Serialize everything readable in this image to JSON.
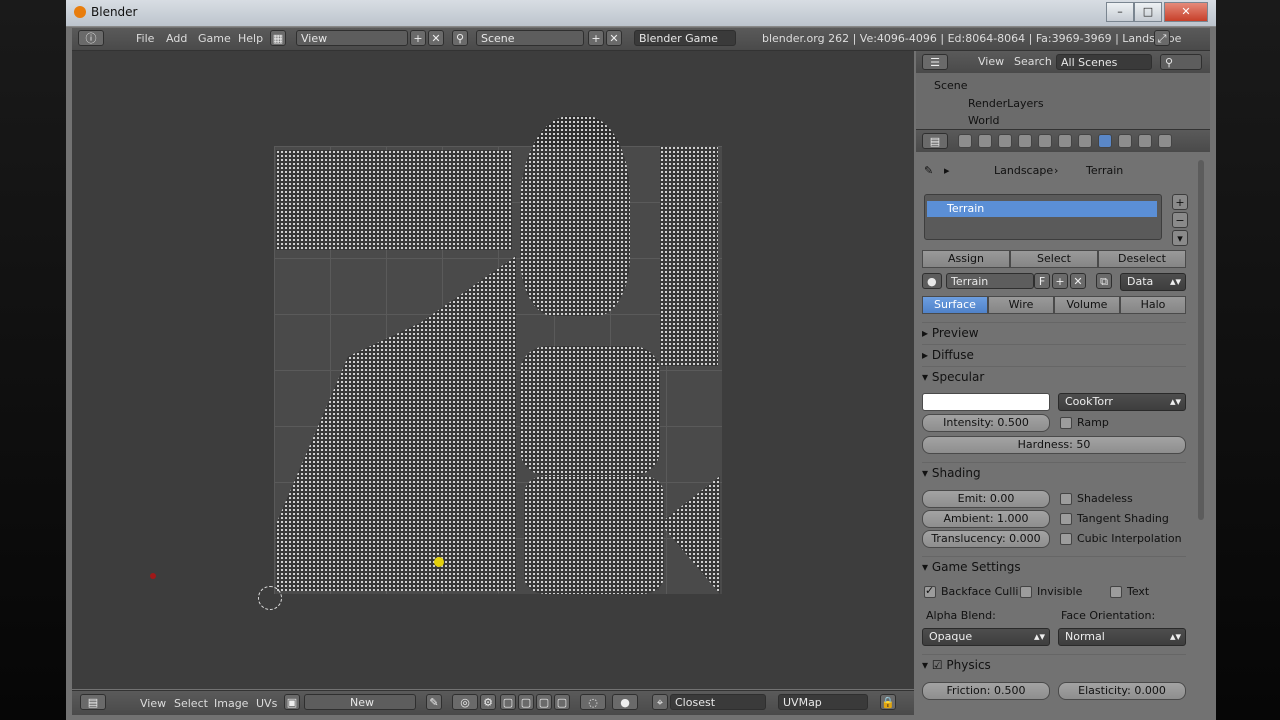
{
  "window": {
    "title": "Blender",
    "min": "–",
    "max": "□",
    "close": "✕"
  },
  "menu": {
    "file": "File",
    "add": "Add",
    "game": "Game",
    "help": "Help",
    "screen": "View",
    "scene": "Scene",
    "engine": "Blender Game",
    "info": "blender.org 262 | Ve:4096-4096 | Ed:8064-8064 | Fa:3969-3969 | Landscape"
  },
  "uv_editor": {
    "view": "View",
    "select": "Select",
    "image": "Image",
    "uvs": "UVs",
    "new_button": "New",
    "sticky_mode": "Closest",
    "uvmap": "UVMap"
  },
  "outliner": {
    "view": "View",
    "search": "Search",
    "filter": "All Scenes",
    "items": [
      "Scene",
      "RenderLayers",
      "World"
    ]
  },
  "properties": {
    "breadcrumb": [
      "Landscape",
      "Terrain"
    ],
    "slot_name": "Terrain",
    "assign": "Assign",
    "select": "Select",
    "deselect": "Deselect",
    "material_name": "Terrain",
    "fake_user": "F",
    "link": "Data",
    "tabs": [
      "Surface",
      "Wire",
      "Volume",
      "Halo"
    ],
    "panels": {
      "preview": "Preview",
      "diffuse": "Diffuse",
      "specular": "Specular",
      "shading": "Shading",
      "game": "Game Settings",
      "physics": "Physics"
    },
    "specular": {
      "shader": "CookTorr",
      "intensity": "Intensity: 0.500",
      "ramp": "Ramp",
      "hardness": "Hardness: 50",
      "color": "#ffffff"
    },
    "shading": {
      "emit": "Emit: 0.00",
      "ambient": "Ambient: 1.000",
      "translucency": "Translucency: 0.000",
      "shadeless": "Shadeless",
      "tangent": "Tangent Shading",
      "cubic": "Cubic Interpolation"
    },
    "game": {
      "backface": "Backface Culli",
      "invisible": "Invisible",
      "text": "Text",
      "alpha_label": "Alpha Blend:",
      "face_label": "Face Orientation:",
      "alpha_value": "Opaque",
      "face_value": "Normal"
    },
    "physics": {
      "friction": "Friction: 0.500",
      "elasticity": "Elasticity: 0.000"
    }
  }
}
